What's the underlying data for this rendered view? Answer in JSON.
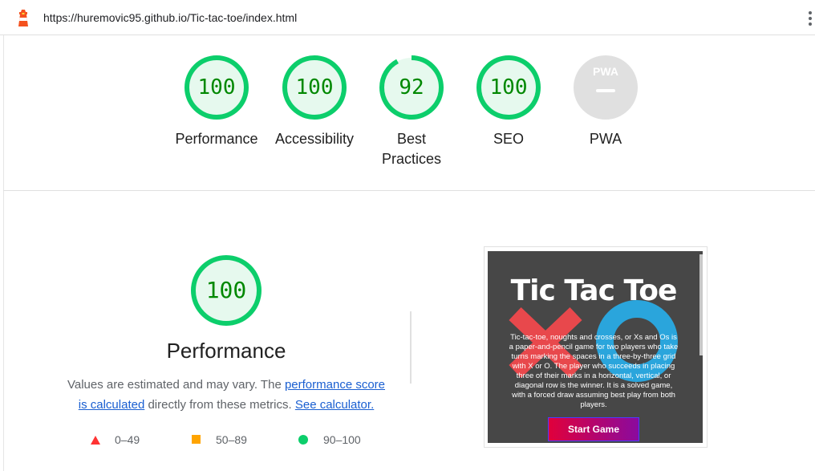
{
  "header": {
    "url": "https://huremovic95.github.io/Tic-tac-toe/index.html",
    "logo_icon": "lighthouse-icon",
    "menu_icon": "kebab-menu-icon"
  },
  "gauges": [
    {
      "label": "Performance",
      "score": "100",
      "value": 100
    },
    {
      "label": "Accessibility",
      "score": "100",
      "value": 100
    },
    {
      "label_line1": "Best",
      "label_line2": "Practices",
      "score": "92",
      "value": 92
    },
    {
      "label": "SEO",
      "score": "100",
      "value": 100
    }
  ],
  "pwa": {
    "badge_text": "PWA",
    "label": "PWA"
  },
  "performance_section": {
    "score": "100",
    "value": 100,
    "title": "Performance",
    "desc_prefix": "Values are estimated and may vary. The ",
    "link_score_1": "performance score",
    "link_score_2": "is calculated",
    "desc_middle": " directly from these metrics. ",
    "link_calculator": "See calculator.",
    "legend": [
      {
        "range": "0–49",
        "icon": "red-triangle-icon",
        "color": "#ff3333"
      },
      {
        "range": "50–89",
        "icon": "orange-square-icon",
        "color": "#ffa400"
      },
      {
        "range": "90–100",
        "icon": "green-circle-icon",
        "color": "#0cce6b"
      }
    ]
  },
  "screenshot": {
    "title": "Tic Tac Toe",
    "body": "Tic-tac-toe, noughts and crosses, or Xs and Os is a paper-and-pencil game for two players who take turns marking the spaces in a three-by-three grid with X or O. The player who succeeds in placing three of their marks in a horizontal, vertical, or diagonal row is the winner. It is a solved game, with a forced draw assuming best play from both players.",
    "button": "Start Game"
  },
  "colors": {
    "pass_green": "#0cce6b",
    "pass_fill": "#e6f9ee",
    "score_text": "#008800",
    "link_blue": "#1a5fd1"
  }
}
